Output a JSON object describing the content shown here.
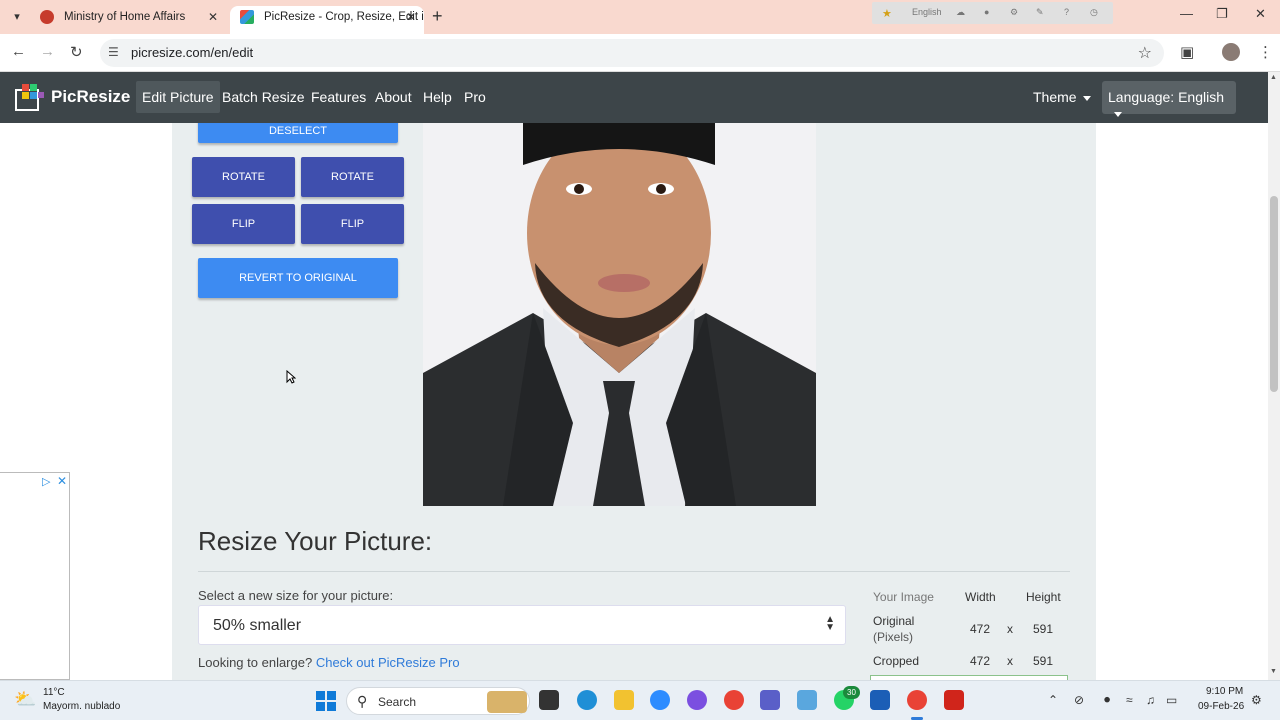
{
  "browser": {
    "tabs": [
      {
        "title": "Ministry of Home Affairs",
        "active": false
      },
      {
        "title": "PicResize - Crop, Resize, Edit im",
        "active": true
      }
    ],
    "new_tab": "+",
    "url": "picresize.com/en/edit",
    "extension_label": "English"
  },
  "site": {
    "brand": "PicResize",
    "nav": [
      "Edit Picture",
      "Batch Resize",
      "Features",
      "About",
      "Help",
      "Pro"
    ],
    "theme_label": "Theme",
    "language_label": "Language: English"
  },
  "editor": {
    "deselect_label": "DESELECT",
    "rotate_left_label": "ROTATE",
    "rotate_right_label": "ROTATE",
    "flip_h_label": "FLIP",
    "flip_v_label": "FLIP",
    "revert_label": "REVERT TO ORIGINAL"
  },
  "resize": {
    "title": "Resize Your Picture:",
    "select_label": "Select a new size for your picture:",
    "selected_size": "50% smaller",
    "enlarge_text": "Looking to enlarge?",
    "enlarge_link": "Check out PicResize Pro",
    "table": {
      "head": [
        "Your Image",
        "Width",
        "Height"
      ],
      "rows": [
        {
          "label": "Original",
          "sub": "(Pixels)",
          "width": "472",
          "x": "x",
          "height": "591"
        },
        {
          "label": "Cropped",
          "sub": "",
          "width": "472",
          "x": "x",
          "height": "591"
        }
      ]
    }
  },
  "taskbar": {
    "temperature": "11°C",
    "weather": "Mayorm. nublado",
    "search": "Search",
    "whatsapp_badge": "30",
    "time": "9:10 PM",
    "date": "09-Feb-26"
  },
  "colors": {
    "nav_bg": "#3d4549",
    "button_blue": "#3d8bf2",
    "button_indigo": "#3f4fae",
    "panel_bg": "#e9eeef",
    "link": "#2f7bd9"
  }
}
